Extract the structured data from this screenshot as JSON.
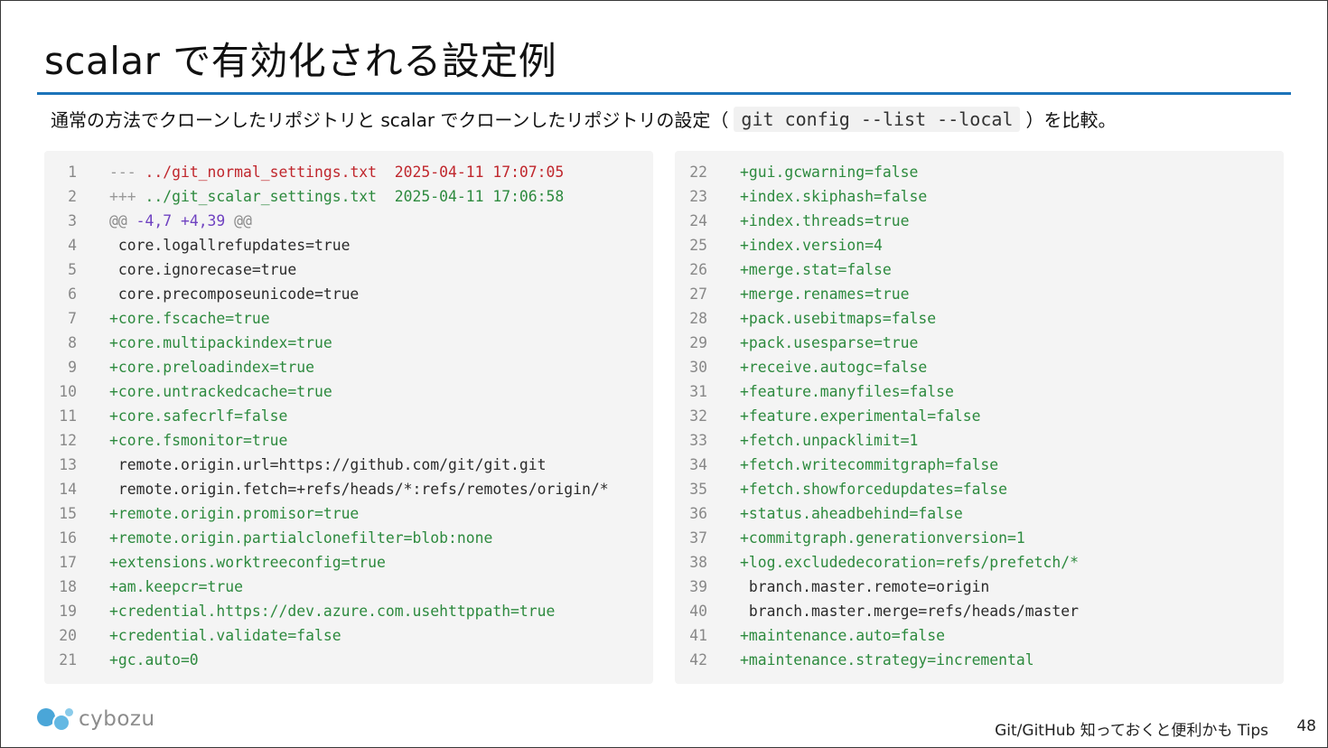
{
  "slide": {
    "title": "scalar で有効化される設定例",
    "subtitle_before": "通常の方法でクローンしたリポジトリと scalar でクローンしたリポジトリの設定（",
    "subtitle_code": "git config --list --local",
    "subtitle_after": "）を比較。"
  },
  "diff": {
    "left": [
      {
        "n": "1",
        "type": "del",
        "mark": "---",
        "text": " ../git_normal_settings.txt  2025-04-11 17:07:05"
      },
      {
        "n": "2",
        "type": "add",
        "mark": "+++",
        "text": " ../git_scalar_settings.txt  2025-04-11 17:06:58"
      },
      {
        "n": "3",
        "type": "hunk",
        "mark": "@@",
        "range": " -4,7 +4,39 ",
        "end": "@@"
      },
      {
        "n": "4",
        "type": "ctx",
        "text": " core.logallrefupdates=true"
      },
      {
        "n": "5",
        "type": "ctx",
        "text": " core.ignorecase=true"
      },
      {
        "n": "6",
        "type": "ctx",
        "text": " core.precomposeunicode=true"
      },
      {
        "n": "7",
        "type": "add",
        "text": "+core.fscache=true"
      },
      {
        "n": "8",
        "type": "add",
        "text": "+core.multipackindex=true"
      },
      {
        "n": "9",
        "type": "add",
        "text": "+core.preloadindex=true"
      },
      {
        "n": "10",
        "type": "add",
        "text": "+core.untrackedcache=true"
      },
      {
        "n": "11",
        "type": "add",
        "text": "+core.safecrlf=false"
      },
      {
        "n": "12",
        "type": "add",
        "text": "+core.fsmonitor=true"
      },
      {
        "n": "13",
        "type": "ctx",
        "text": " remote.origin.url=https://github.com/git/git.git"
      },
      {
        "n": "14",
        "type": "ctx",
        "text": " remote.origin.fetch=+refs/heads/*:refs/remotes/origin/*"
      },
      {
        "n": "15",
        "type": "add",
        "text": "+remote.origin.promisor=true"
      },
      {
        "n": "16",
        "type": "add",
        "text": "+remote.origin.partialclonefilter=blob:none"
      },
      {
        "n": "17",
        "type": "add",
        "text": "+extensions.worktreeconfig=true"
      },
      {
        "n": "18",
        "type": "add",
        "text": "+am.keepcr=true"
      },
      {
        "n": "19",
        "type": "add",
        "text": "+credential.https://dev.azure.com.usehttppath=true"
      },
      {
        "n": "20",
        "type": "add",
        "text": "+credential.validate=false"
      },
      {
        "n": "21",
        "type": "add",
        "text": "+gc.auto=0"
      }
    ],
    "right": [
      {
        "n": "22",
        "type": "add",
        "text": "+gui.gcwarning=false"
      },
      {
        "n": "23",
        "type": "add",
        "text": "+index.skiphash=false"
      },
      {
        "n": "24",
        "type": "add",
        "text": "+index.threads=true"
      },
      {
        "n": "25",
        "type": "add",
        "text": "+index.version=4"
      },
      {
        "n": "26",
        "type": "add",
        "text": "+merge.stat=false"
      },
      {
        "n": "27",
        "type": "add",
        "text": "+merge.renames=true"
      },
      {
        "n": "28",
        "type": "add",
        "text": "+pack.usebitmaps=false"
      },
      {
        "n": "29",
        "type": "add",
        "text": "+pack.usesparse=true"
      },
      {
        "n": "30",
        "type": "add",
        "text": "+receive.autogc=false"
      },
      {
        "n": "31",
        "type": "add",
        "text": "+feature.manyfiles=false"
      },
      {
        "n": "32",
        "type": "add",
        "text": "+feature.experimental=false"
      },
      {
        "n": "33",
        "type": "add",
        "text": "+fetch.unpacklimit=1"
      },
      {
        "n": "34",
        "type": "add",
        "text": "+fetch.writecommitgraph=false"
      },
      {
        "n": "35",
        "type": "add",
        "text": "+fetch.showforcedupdates=false"
      },
      {
        "n": "36",
        "type": "add",
        "text": "+status.aheadbehind=false"
      },
      {
        "n": "37",
        "type": "add",
        "text": "+commitgraph.generationversion=1"
      },
      {
        "n": "38",
        "type": "add",
        "text": "+log.excludedecoration=refs/prefetch/*"
      },
      {
        "n": "39",
        "type": "ctx",
        "text": " branch.master.remote=origin"
      },
      {
        "n": "40",
        "type": "ctx",
        "text": " branch.master.merge=refs/heads/master"
      },
      {
        "n": "41",
        "type": "add",
        "text": "+maintenance.auto=false"
      },
      {
        "n": "42",
        "type": "add",
        "text": "+maintenance.strategy=incremental"
      }
    ]
  },
  "footer": {
    "logo_text": "cybozu",
    "deck_title": "Git/GitHub 知っておくと便利かも Tips",
    "page_number": "48"
  },
  "colors": {
    "accent_rule": "#1c73b9",
    "add": "#2d8a3e",
    "del": "#c0272d",
    "hunk_range": "#6f42c1",
    "code_bg": "#f4f4f4"
  }
}
